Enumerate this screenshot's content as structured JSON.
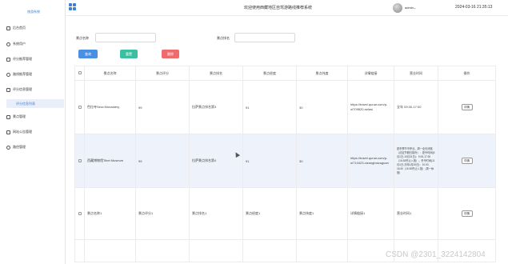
{
  "header": {
    "title": "欢迎使用西藏地区自驾游路线推荐系统",
    "username": "admin",
    "datetime": "2024-03-16 21:35:13"
  },
  "sidebar": {
    "system_name": "旅游系统",
    "items": [
      {
        "label": "后台首页",
        "icon": "home-icon"
      },
      {
        "label": "系统用户",
        "icon": "user-icon"
      },
      {
        "label": "评分推荐管理",
        "icon": "star-icon"
      },
      {
        "label": "路线推荐管理",
        "icon": "route-icon"
      },
      {
        "label": "评分信息管理",
        "icon": "list-icon"
      },
      {
        "label": "评分信息列表",
        "icon": "",
        "sub": true
      },
      {
        "label": "景点管理",
        "icon": "location-icon"
      },
      {
        "label": "网站公告管理",
        "icon": "notice-icon"
      },
      {
        "label": "路径管理",
        "icon": "path-icon"
      }
    ]
  },
  "search": {
    "name_label": "景点名称",
    "name_value": "",
    "rank_label": "景点排名",
    "rank_value": "",
    "query_button": "查询",
    "reset_button": "重置",
    "delete_button": "删除"
  },
  "colors": {
    "accent": "#3b82d6",
    "query": "#4a90e2",
    "reset": "#3bbfa0",
    "delete": "#ef6b6b"
  },
  "table": {
    "headers": [
      "景点名称",
      "景点评分",
      "景点排名",
      "景点经度",
      "景点纬度",
      "详情链接",
      "营业时间",
      "操作"
    ],
    "rows": [
      {
        "name": "色拉寺Sera Monastery",
        "score": "99",
        "rank": "拉萨景点排名第3",
        "lng": "91",
        "lat": "30",
        "link": "https://travel.qunar.com/p-oi709820-selasi",
        "hours": "全年 09:30-17:00",
        "op": "详情"
      },
      {
        "name": "西藏博物馆Tibet Museum",
        "score": "99",
        "rank": "拉萨景点排名第4",
        "lng": "91",
        "lat": "30",
        "link": "https://travel.qunar.com/p-oi710423-xizangbowuguan",
        "hours": "夏冬季节不停业，周一全天闭馆（法定节假日除外）：夏令时间(5月1日-10月31日)：9:00-17:30（16:30停止入馆）；冬令时间(11月1日-次年4月30日)：10:00-16:30（15:30停止入馆）（周一休馆）",
        "op": "详情"
      },
      {
        "name": "景点名称1",
        "score": "景点评分1",
        "rank": "景点排名1",
        "lng": "景点经度1",
        "lat": "景点纬度1",
        "link": "详情链接1",
        "hours": "营业时间1",
        "op": "详情"
      },
      {
        "name": "",
        "score": "",
        "rank": "",
        "lng": "",
        "lat": "",
        "link": "",
        "hours": "",
        "op": ""
      }
    ]
  },
  "watermark": "CSDN @2301_3224142804"
}
